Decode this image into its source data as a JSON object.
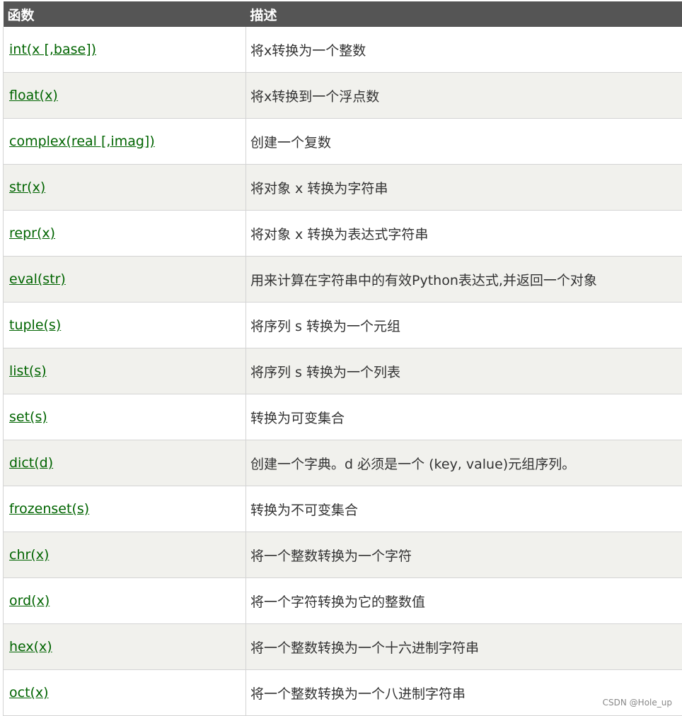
{
  "table": {
    "headers": [
      "函数",
      "描述"
    ],
    "rows": [
      {
        "func": "int(x [,base])",
        "desc": "将x转换为一个整数"
      },
      {
        "func": "float(x)",
        "desc": "将x转换到一个浮点数"
      },
      {
        "func": "complex(real [,imag])",
        "desc": "创建一个复数"
      },
      {
        "func": "str(x)",
        "desc": "将对象 x 转换为字符串"
      },
      {
        "func": "repr(x)",
        "desc": "将对象 x 转换为表达式字符串"
      },
      {
        "func": "eval(str)",
        "desc": "用来计算在字符串中的有效Python表达式,并返回一个对象"
      },
      {
        "func": "tuple(s)",
        "desc": "将序列 s 转换为一个元组"
      },
      {
        "func": "list(s)",
        "desc": "将序列 s 转换为一个列表"
      },
      {
        "func": "set(s)",
        "desc": "转换为可变集合"
      },
      {
        "func": "dict(d)",
        "desc": "创建一个字典。d 必须是一个 (key, value)元组序列。"
      },
      {
        "func": "frozenset(s)",
        "desc": "转换为不可变集合"
      },
      {
        "func": "chr(x)",
        "desc": "将一个整数转换为一个字符"
      },
      {
        "func": "ord(x)",
        "desc": "将一个字符转换为它的整数值"
      },
      {
        "func": "hex(x)",
        "desc": "将一个整数转换为一个十六进制字符串"
      },
      {
        "func": "oct(x)",
        "desc": "将一个整数转换为一个八进制字符串"
      }
    ]
  },
  "watermark": "CSDN @Hole_up",
  "colors": {
    "header_bg": "#555555",
    "link": "#006400",
    "alt_row": "#f1f1ed"
  }
}
